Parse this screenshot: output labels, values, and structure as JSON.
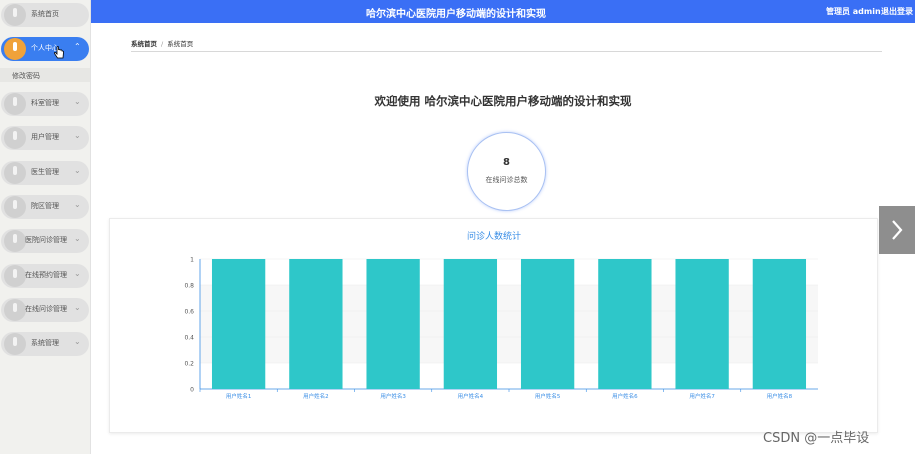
{
  "app": {
    "title": "哈尔滨中心医院用户移动端的设计和实现",
    "user_label": "管理员 admin",
    "logout_label": "退出登录"
  },
  "sidebar": {
    "items": [
      {
        "label": "系统首页",
        "icon": "menu-icon",
        "active": false,
        "has_chevron": false
      },
      {
        "label": "个人中心",
        "icon": "medal-icon",
        "active": true,
        "has_chevron": true
      },
      {
        "label": "科室管理",
        "icon": "menu-icon",
        "active": false,
        "has_chevron": true
      },
      {
        "label": "用户管理",
        "icon": "menu-icon",
        "active": false,
        "has_chevron": true
      },
      {
        "label": "医生管理",
        "icon": "menu-icon",
        "active": false,
        "has_chevron": true
      },
      {
        "label": "院区管理",
        "icon": "menu-icon",
        "active": false,
        "has_chevron": true
      },
      {
        "label": "医院问诊管理",
        "icon": "menu-icon",
        "active": false,
        "has_chevron": true
      },
      {
        "label": "在线预约管理",
        "icon": "menu-icon",
        "active": false,
        "has_chevron": true
      },
      {
        "label": "在线问诊管理",
        "icon": "menu-icon",
        "active": false,
        "has_chevron": true
      },
      {
        "label": "系统管理",
        "icon": "menu-icon",
        "active": false,
        "has_chevron": true
      }
    ],
    "submenu": {
      "label": "修改密码"
    }
  },
  "breadcrumb": {
    "root": "系统首页",
    "separator": "/",
    "current": "系统首页"
  },
  "welcome": "欢迎使用 哈尔滨中心医院用户移动端的设计和实现",
  "stat": {
    "value": "8",
    "label": "在线问诊总数"
  },
  "chart_data": {
    "type": "bar",
    "title": "问诊人数统计",
    "categories": [
      "用户姓名1",
      "用户姓名2",
      "用户姓名3",
      "用户姓名4",
      "用户姓名5",
      "用户姓名6",
      "用户姓名7",
      "用户姓名8"
    ],
    "values": [
      1,
      1,
      1,
      1,
      1,
      1,
      1,
      1
    ],
    "yticks": [
      "0",
      "0.2",
      "0.4",
      "0.6",
      "0.8",
      "1"
    ],
    "ylim": [
      0,
      1
    ],
    "bar_color": "#2ec7c9",
    "grid": true
  },
  "watermark": "CSDN @一点毕设",
  "colors": {
    "topbar": "#3a6ff5",
    "active_menu": "#3a7ef0",
    "chart_title": "#3a8ee6"
  }
}
